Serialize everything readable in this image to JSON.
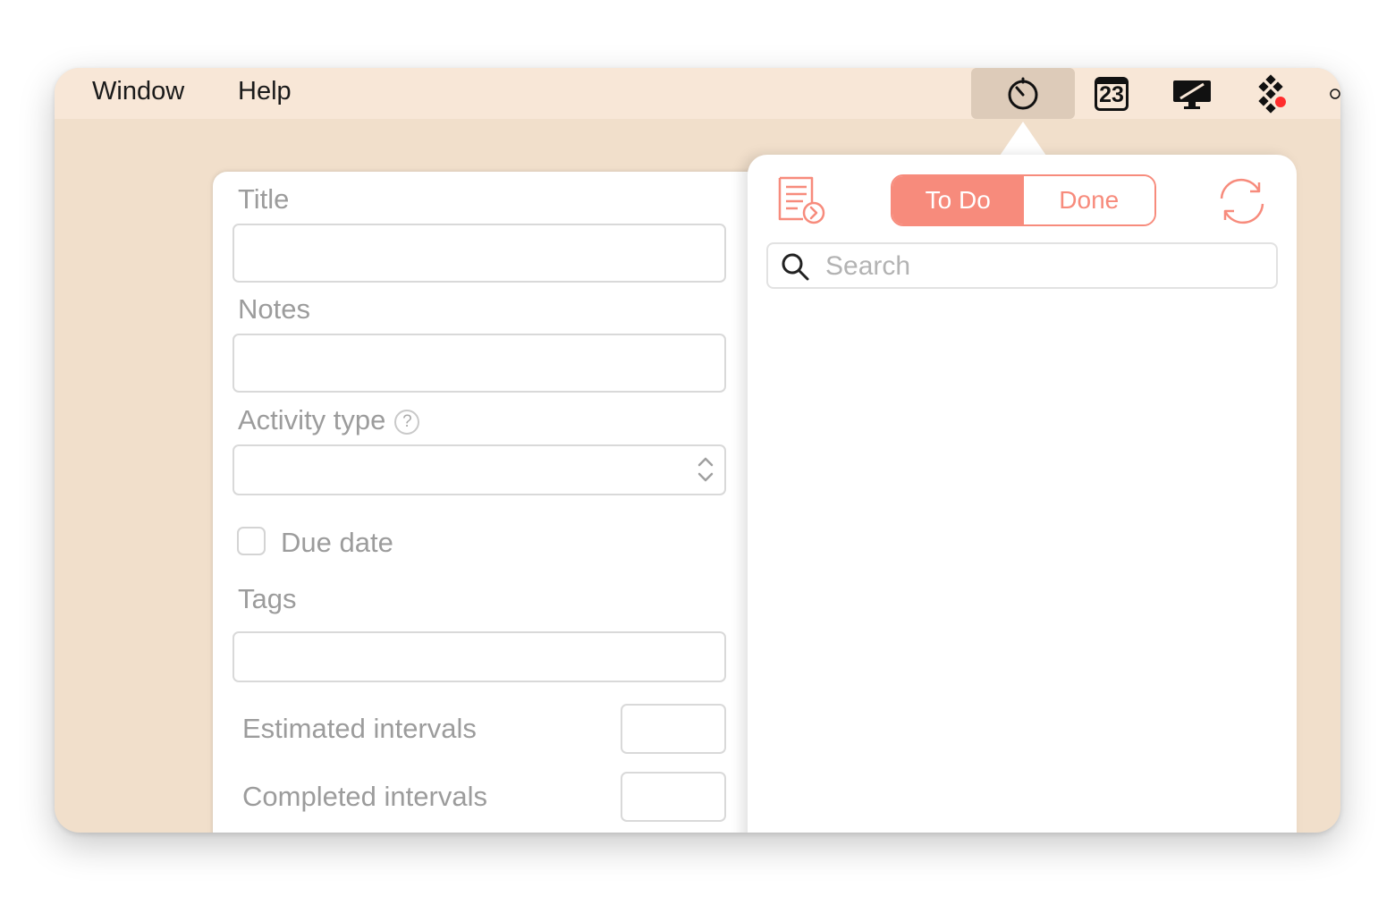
{
  "menubar": {
    "items": [
      {
        "label": "Window"
      },
      {
        "label": "Help"
      }
    ],
    "tray": {
      "timer_icon": "stopwatch-icon",
      "calendar_day": "23",
      "display_icon": "display-icon",
      "app_icon": "dots-grid-icon",
      "partial_icon": "partial-icon"
    }
  },
  "form": {
    "title_label": "Title",
    "title_value": "",
    "notes_label": "Notes",
    "notes_value": "",
    "activity_type_label": "Activity type",
    "activity_type_help": "?",
    "activity_type_value": "",
    "due_date_label": "Due date",
    "due_date_checked": false,
    "tags_label": "Tags",
    "tags_value": "",
    "estimated_intervals_label": "Estimated intervals",
    "estimated_intervals_value": "",
    "completed_intervals_label": "Completed intervals",
    "completed_intervals_value": ""
  },
  "popover": {
    "tabs": [
      {
        "label": "To Do",
        "selected": true
      },
      {
        "label": "Done",
        "selected": false
      }
    ],
    "search_placeholder": "Search",
    "accent_color": "#f78b7c"
  }
}
